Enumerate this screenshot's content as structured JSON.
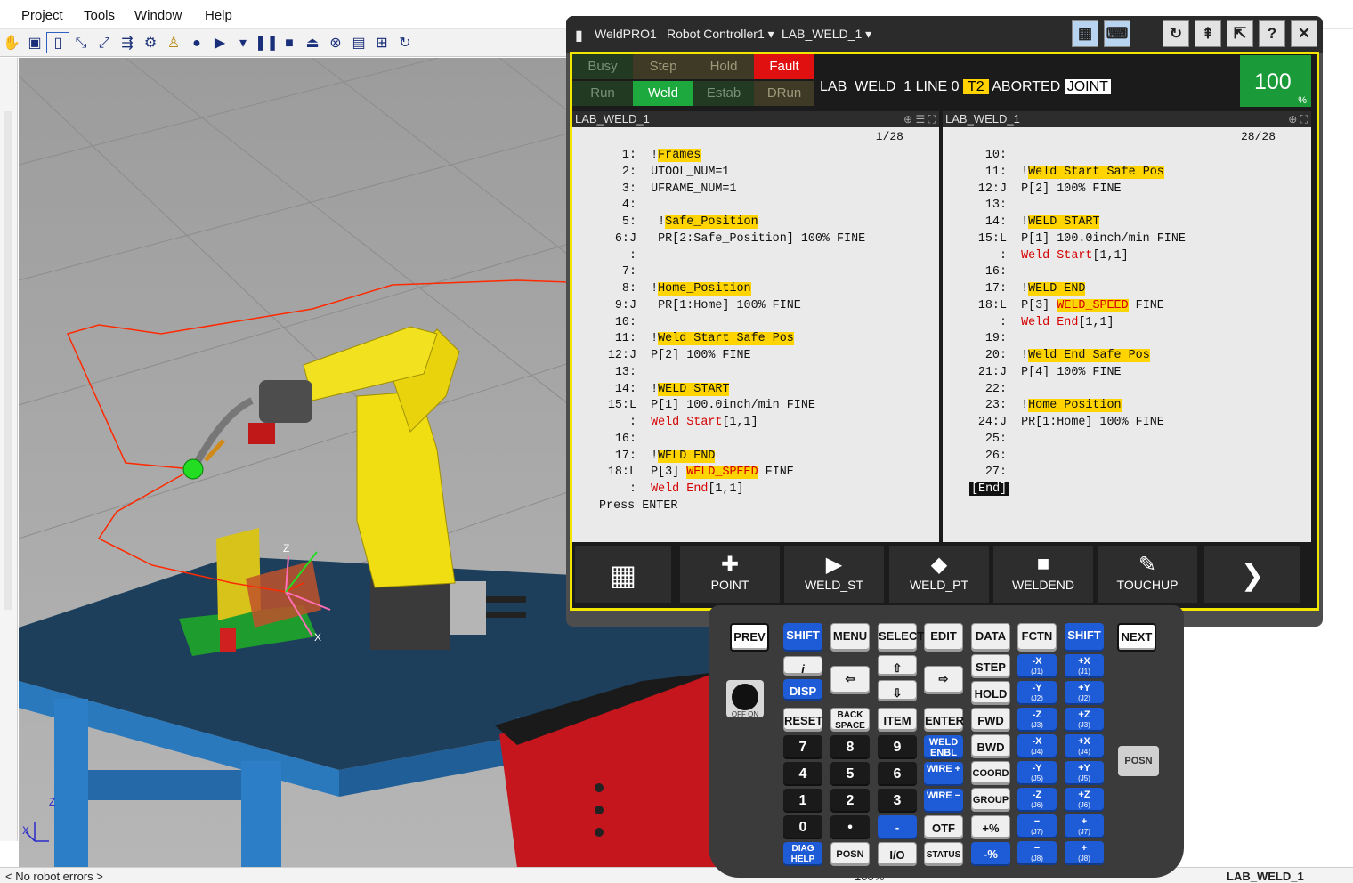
{
  "menu": [
    "Project",
    "Tools",
    "Window",
    "Help"
  ],
  "toolbar_icons": [
    "hand-icon",
    "camera-icon",
    "teach-pendant-icon",
    "jog-icon",
    "jog-frame-icon",
    "move-icon",
    "robot-icon",
    "person-icon",
    "record-icon",
    "play-icon",
    "step-icon",
    "pause-icon",
    "stop-icon",
    "eject-icon",
    "abort-icon",
    "display-icon",
    "plugins-icon",
    "refresh-icon"
  ],
  "status_bar": {
    "left": "< No robot errors >",
    "center": "100%",
    "right": "LAB_WELD_1"
  },
  "pendant": {
    "title": {
      "app": "WeldPRO1",
      "controller": "Robot Controller1 ▾",
      "program": "LAB_WELD_1 ▾"
    },
    "status_buttons": [
      {
        "label": "Busy",
        "bg": "#223a22",
        "fg": "#7a8f7a"
      },
      {
        "label": "Step",
        "bg": "#3f3a26",
        "fg": "#9d9a7b"
      },
      {
        "label": "Hold",
        "bg": "#3f3a26",
        "fg": "#9d9a7b"
      },
      {
        "label": "Fault",
        "bg": "#e01010",
        "fg": "#ffffff"
      },
      {
        "label": "Run",
        "bg": "#223a22",
        "fg": "#7a8f7a"
      },
      {
        "label": "Weld",
        "bg": "#1ea93f",
        "fg": "#ffffff"
      },
      {
        "label": "Estab",
        "bg": "#223a22",
        "fg": "#7a8f7a"
      },
      {
        "label": "DRun",
        "bg": "#3f3a26",
        "fg": "#9d9a7b"
      }
    ],
    "prog_status": {
      "text": "LAB_WELD_1 LINE 0",
      "mode": "T2",
      "state": "ABORTED",
      "coord": "JOINT"
    },
    "override": {
      "value": "100",
      "unit": "%"
    },
    "left_pane": {
      "title": "LAB_WELD_1",
      "position": "1/28"
    },
    "right_pane": {
      "title": "LAB_WELD_1",
      "position": "28/28"
    },
    "left_lines": [
      {
        "n": "1:",
        "parts": [
          {
            "t": "!"
          },
          {
            "t": "Frames",
            "c": "hl"
          }
        ]
      },
      {
        "n": "2:",
        "parts": [
          {
            "t": "UTOOL_NUM=1"
          }
        ]
      },
      {
        "n": "3:",
        "parts": [
          {
            "t": "UFRAME_NUM=1"
          }
        ]
      },
      {
        "n": "4:",
        "parts": []
      },
      {
        "n": "5:",
        "parts": [
          {
            "t": " !"
          },
          {
            "t": "Safe_Position",
            "c": "hl"
          }
        ]
      },
      {
        "n": "6:J",
        "parts": [
          {
            "t": " PR[2:Safe_Position] 100% FINE"
          }
        ]
      },
      {
        "n": ":",
        "parts": []
      },
      {
        "n": "7:",
        "parts": []
      },
      {
        "n": "8:",
        "parts": [
          {
            "t": "!"
          },
          {
            "t": "Home_Position",
            "c": "hl"
          }
        ]
      },
      {
        "n": "9:J",
        "parts": [
          {
            "t": " PR[1:Home] 100% FINE"
          }
        ]
      },
      {
        "n": "10:",
        "parts": []
      },
      {
        "n": "11:",
        "parts": [
          {
            "t": "!"
          },
          {
            "t": "Weld Start Safe Pos",
            "c": "hl"
          }
        ]
      },
      {
        "n": "12:J",
        "parts": [
          {
            "t": "P[2] 100% FINE"
          }
        ]
      },
      {
        "n": "13:",
        "parts": []
      },
      {
        "n": "14:",
        "parts": [
          {
            "t": "!"
          },
          {
            "t": "WELD START",
            "c": "hl"
          }
        ]
      },
      {
        "n": "15:L",
        "parts": [
          {
            "t": "P[1] 100.0inch/min FINE"
          }
        ]
      },
      {
        "n": ":",
        "parts": [
          {
            "t": "Weld Start",
            "c": "red"
          },
          {
            "t": "[1,1]"
          }
        ]
      },
      {
        "n": "16:",
        "parts": []
      },
      {
        "n": "17:",
        "parts": [
          {
            "t": "!"
          },
          {
            "t": "WELD END",
            "c": "hl"
          }
        ]
      },
      {
        "n": "18:L",
        "parts": [
          {
            "t": "P[3] "
          },
          {
            "t": "WELD_SPEED",
            "c": "hlb"
          },
          {
            "t": " FINE"
          }
        ]
      },
      {
        "n": ":",
        "parts": [
          {
            "t": "Weld",
            "c": "red"
          },
          {
            "t": " "
          },
          {
            "t": "End",
            "c": "red"
          },
          {
            "t": "[1,1]"
          }
        ]
      },
      {
        "n": "",
        "parts": [
          {
            "t": "Press ENTER"
          }
        ]
      }
    ],
    "right_lines": [
      {
        "n": "10:",
        "parts": []
      },
      {
        "n": "11:",
        "parts": [
          {
            "t": "!"
          },
          {
            "t": "Weld Start Safe Pos",
            "c": "hl"
          }
        ]
      },
      {
        "n": "12:J",
        "parts": [
          {
            "t": "P[2] 100% FINE"
          }
        ]
      },
      {
        "n": "13:",
        "parts": []
      },
      {
        "n": "14:",
        "parts": [
          {
            "t": "!"
          },
          {
            "t": "WELD START",
            "c": "hl"
          }
        ]
      },
      {
        "n": "15:L",
        "parts": [
          {
            "t": "P[1] 100.0inch/min FINE"
          }
        ]
      },
      {
        "n": ":",
        "parts": [
          {
            "t": "Weld Start",
            "c": "red"
          },
          {
            "t": "[1,1]"
          }
        ]
      },
      {
        "n": "16:",
        "parts": []
      },
      {
        "n": "17:",
        "parts": [
          {
            "t": "!"
          },
          {
            "t": "WELD END",
            "c": "hl"
          }
        ]
      },
      {
        "n": "18:L",
        "parts": [
          {
            "t": "P[3] "
          },
          {
            "t": "WELD_SPEED",
            "c": "hlb"
          },
          {
            "t": " FINE"
          }
        ]
      },
      {
        "n": ":",
        "parts": [
          {
            "t": "Weld End",
            "c": "red"
          },
          {
            "t": "[1,1]"
          }
        ]
      },
      {
        "n": "19:",
        "parts": []
      },
      {
        "n": "20:",
        "parts": [
          {
            "t": "!"
          },
          {
            "t": "Weld End Safe Pos",
            "c": "hl"
          }
        ]
      },
      {
        "n": "21:J",
        "parts": [
          {
            "t": "P[4] 100% FINE"
          }
        ]
      },
      {
        "n": "22:",
        "parts": []
      },
      {
        "n": "23:",
        "parts": [
          {
            "t": "!"
          },
          {
            "t": "Home_Position",
            "c": "hl"
          }
        ]
      },
      {
        "n": "24:J",
        "parts": [
          {
            "t": "PR[1:Home] 100% FINE"
          }
        ]
      },
      {
        "n": "25:",
        "parts": []
      },
      {
        "n": "26:",
        "parts": []
      },
      {
        "n": "27:",
        "parts": []
      },
      {
        "n": "",
        "parts": [
          {
            "t": "[End]",
            "c": "endtag"
          }
        ]
      }
    ],
    "function_keys": [
      {
        "name": "menu-grid-key",
        "label": "",
        "icon": "▦"
      },
      {
        "name": "point-key",
        "label": "POINT",
        "icon": "✚"
      },
      {
        "name": "weld-st-key",
        "label": "WELD_ST",
        "icon": "▶"
      },
      {
        "name": "weld-pt-key",
        "label": "WELD_PT",
        "icon": "◆"
      },
      {
        "name": "weldend-key",
        "label": "WELDEND",
        "icon": "■"
      },
      {
        "name": "touchup-key",
        "label": "TOUCHUP",
        "icon": "✎"
      },
      {
        "name": "next-page-key",
        "label": "",
        "icon": "❯"
      }
    ]
  },
  "keypad": {
    "row1": [
      "PREV",
      "SHIFT",
      "MENU",
      "SELECT",
      "EDIT",
      "DATA",
      "FCTN",
      "SHIFT",
      "NEXT"
    ],
    "info": "i",
    "disp": "DISP",
    "arrows": {
      "up": "⇧",
      "down": "⇩",
      "left": "⇦",
      "right": "⇨"
    },
    "step": "STEP",
    "hold": "HOLD",
    "fwd": "FWD",
    "bwd": "BWD",
    "coord": "COORD",
    "group": "GROUP",
    "reset": "RESET",
    "backspace": "BACK SPACE",
    "item": "ITEM",
    "enter": "ENTER",
    "digits": [
      "7",
      "8",
      "9",
      "4",
      "5",
      "6",
      "1",
      "2",
      "3",
      "0",
      "•"
    ],
    "minus": "-",
    "weld_enbl": "WELD ENBL",
    "wire_plus": "WIRE +",
    "wire_minus": "WIRE −",
    "otf": "OTF",
    "plus_pct": "+%",
    "minus_pct": "-%",
    "diag": "DIAG HELP",
    "posn": "POSN",
    "io": "I/O",
    "status": "STATUS",
    "jog": [
      {
        "s": "-X",
        "j": "(J1)"
      },
      {
        "s": "+X",
        "j": "(J1)"
      },
      {
        "s": "-Y",
        "j": "(J2)"
      },
      {
        "s": "+Y",
        "j": "(J2)"
      },
      {
        "s": "-Z",
        "j": "(J3)"
      },
      {
        "s": "+Z",
        "j": "(J3)"
      },
      {
        "s": "-X",
        "j": "(J4)"
      },
      {
        "s": "+X",
        "j": "(J4)"
      },
      {
        "s": "-Y",
        "j": "(J5)"
      },
      {
        "s": "+Y",
        "j": "(J5)"
      },
      {
        "s": "-Z",
        "j": "(J6)"
      },
      {
        "s": "+Z",
        "j": "(J6)"
      },
      {
        "s": "−",
        "j": "(J7)"
      },
      {
        "s": "+",
        "j": "(J7)"
      },
      {
        "s": "−",
        "j": "(J8)"
      },
      {
        "s": "+",
        "j": "(J8)"
      }
    ],
    "posn_side": "POSN",
    "dial": "OFF ON"
  },
  "scene_labels": {
    "axis_x": "X",
    "axis_z": "Z",
    "frame_z": "Z",
    "frame_x": "X"
  }
}
